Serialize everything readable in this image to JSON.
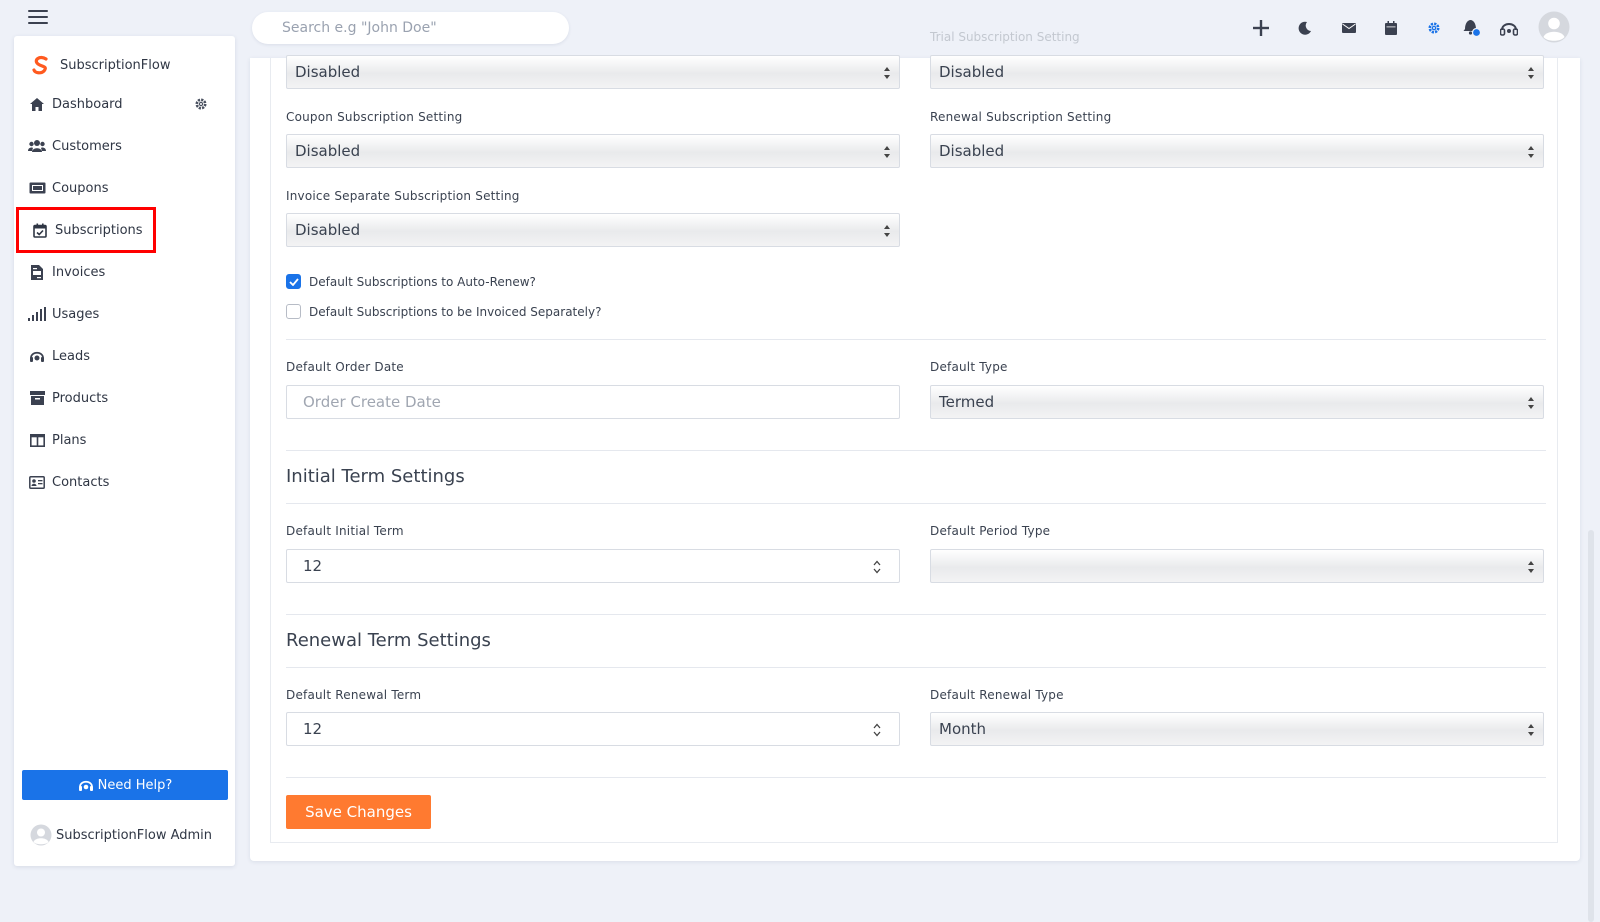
{
  "brand": {
    "name": "SubscriptionFlow"
  },
  "search": {
    "placeholder": "Search e.g \"John Doe\""
  },
  "sidebar": {
    "items": [
      {
        "label": "Dashboard",
        "icon": "home-icon"
      },
      {
        "label": "Customers",
        "icon": "users-icon"
      },
      {
        "label": "Coupons",
        "icon": "ticket-icon"
      },
      {
        "label": "Subscriptions",
        "icon": "calendar-check-icon",
        "active": true
      },
      {
        "label": "Invoices",
        "icon": "file-invoice-icon"
      },
      {
        "label": "Usages",
        "icon": "signal-bars-icon"
      },
      {
        "label": "Leads",
        "icon": "headset-icon"
      },
      {
        "label": "Products",
        "icon": "archive-box-icon"
      },
      {
        "label": "Plans",
        "icon": "columns-icon"
      },
      {
        "label": "Contacts",
        "icon": "contact-card-icon"
      }
    ],
    "help_label": "Need Help?",
    "user_name": "SubscriptionFlow Admin"
  },
  "topbar_icons": [
    "plus-icon",
    "moon-icon",
    "envelope-icon",
    "calendar-icon",
    "gear-icon",
    "bell-icon",
    "headset-icon",
    "avatar"
  ],
  "colors": {
    "primary": "#1a73e8",
    "accent": "#ff7a30",
    "highlight": "#ff0000",
    "brand": "#ff5a1f"
  },
  "form": {
    "ghost_label": "Trial Subscription Setting",
    "row1": {
      "left_value": "Disabled",
      "right_value": "Disabled"
    },
    "coupon": {
      "label": "Coupon Subscription Setting",
      "value": "Disabled"
    },
    "renewal": {
      "label": "Renewal Subscription Setting",
      "value": "Disabled"
    },
    "invoice_separate": {
      "label": "Invoice Separate Subscription Setting",
      "value": "Disabled"
    },
    "checkboxes": [
      {
        "label": "Default Subscriptions to Auto-Renew?",
        "checked": true
      },
      {
        "label": "Default Subscriptions to be Invoiced Separately?",
        "checked": false
      }
    ],
    "order_date": {
      "label": "Default Order Date",
      "placeholder": "Order Create Date"
    },
    "default_type": {
      "label": "Default Type",
      "value": "Termed"
    },
    "initial_term": {
      "heading": "Initial Term Settings",
      "term_label": "Default Initial Term",
      "term_value": "12",
      "period_label": "Default Period Type",
      "period_value": ""
    },
    "renewal_term": {
      "heading": "Renewal Term Settings",
      "term_label": "Default Renewal Term",
      "term_value": "12",
      "type_label": "Default Renewal Type",
      "type_value": "Month"
    },
    "save_label": "Save Changes"
  }
}
